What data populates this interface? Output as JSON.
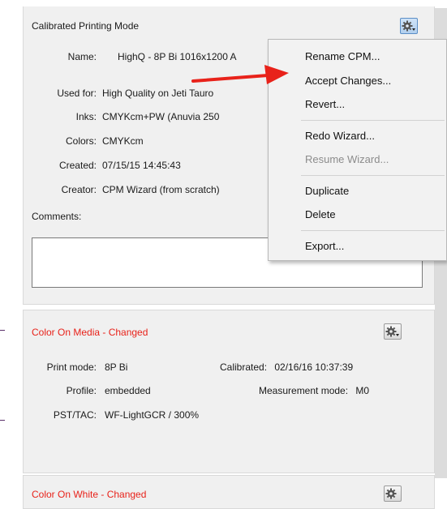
{
  "cpm": {
    "title": "Calibrated Printing Mode",
    "fields": {
      "name_label": "Name:",
      "name_value": "HighQ - 8P Bi 1016x1200 A",
      "used_for_label": "Used for:",
      "used_for_value": "High Quality on Jeti Tauro",
      "inks_label": "Inks:",
      "inks_value": "CMYKcm+PW (Anuvia 250",
      "colors_label": "Colors:",
      "colors_value": "CMYKcm",
      "created_label": "Created:",
      "created_value": "07/15/15 14:45:43",
      "creator_label": "Creator:",
      "creator_value": "CPM Wizard (from scratch)"
    },
    "comments_label": "Comments:",
    "comments_value": ""
  },
  "context_menu": {
    "items": [
      {
        "label": "Rename CPM...",
        "enabled": true
      },
      {
        "label": "Accept Changes...",
        "enabled": true
      },
      {
        "label": "Revert...",
        "enabled": true
      },
      {
        "label": "Redo Wizard...",
        "enabled": true
      },
      {
        "label": "Resume Wizard...",
        "enabled": false
      },
      {
        "label": "Duplicate",
        "enabled": true
      },
      {
        "label": "Delete",
        "enabled": true
      },
      {
        "label": "Export...",
        "enabled": true
      }
    ]
  },
  "color_on_media": {
    "title": "Color On Media - Changed",
    "print_mode_label": "Print mode:",
    "print_mode_value": "8P Bi",
    "calibrated_label": "Calibrated:",
    "calibrated_value": "02/16/16 10:37:39",
    "profile_label": "Profile:",
    "profile_value": "embedded",
    "measurement_label": "Measurement mode:",
    "measurement_value": "M0",
    "pst_label": "PST/TAC:",
    "pst_value": "WF-LightGCR / 300%"
  },
  "color_on_white": {
    "title": "Color On White - Changed"
  },
  "colors": {
    "changed_text": "#e8221a",
    "annotation_arrow": "#e8221a"
  },
  "icons": [
    "gear-icon",
    "dropdown-arrow-icon"
  ]
}
